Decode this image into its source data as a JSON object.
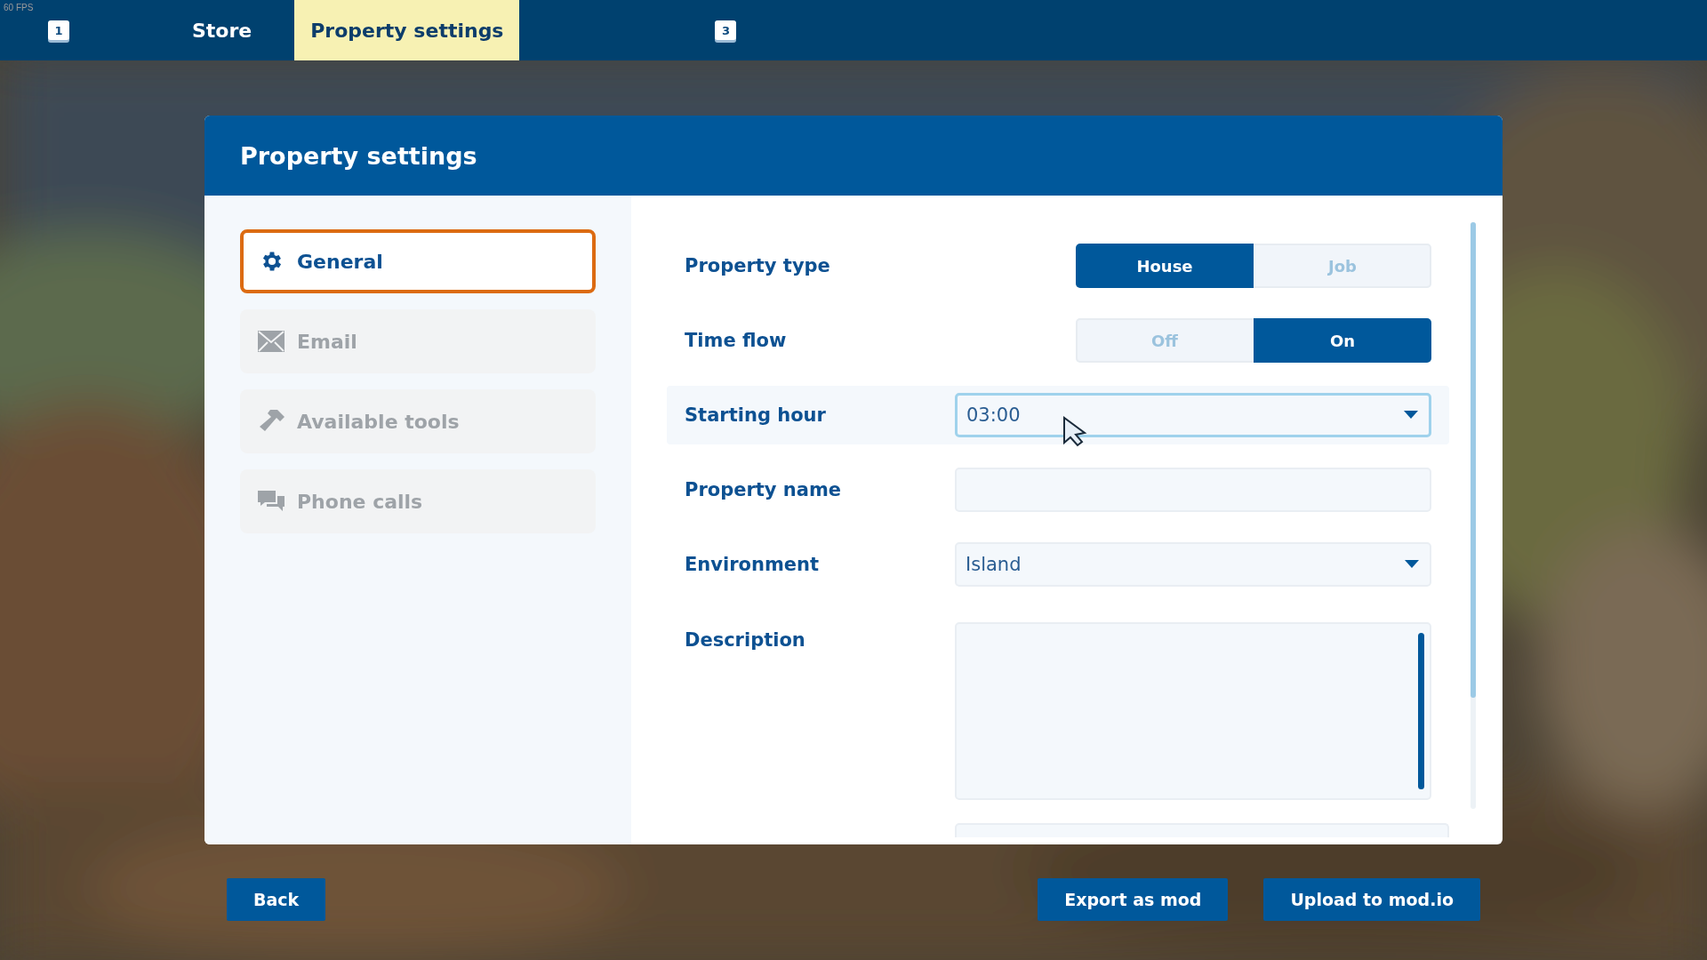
{
  "fps": "60 FPS",
  "tabs": [
    {
      "kind": "key",
      "label": "1",
      "selected": false
    },
    {
      "kind": "label",
      "label": "Store",
      "selected": false
    },
    {
      "kind": "label",
      "label": "Property settings",
      "selected": true
    },
    {
      "kind": "key",
      "label": "3",
      "selected": false
    }
  ],
  "panel": {
    "title": "Property settings"
  },
  "sidebar": {
    "items": [
      {
        "label": "General",
        "selected": true,
        "disabled": false
      },
      {
        "label": "Email",
        "selected": false,
        "disabled": true
      },
      {
        "label": "Available tools",
        "selected": false,
        "disabled": true
      },
      {
        "label": "Phone calls",
        "selected": false,
        "disabled": true
      }
    ]
  },
  "fields": [
    {
      "kind": "segmented",
      "label": "Property type",
      "focused": false,
      "options": [
        {
          "label": "House",
          "selected": true
        },
        {
          "label": "Job",
          "selected": false
        }
      ]
    },
    {
      "kind": "segmented",
      "label": "Time flow",
      "focused": false,
      "options": [
        {
          "label": "Off",
          "selected": false
        },
        {
          "label": "On",
          "selected": true
        }
      ]
    },
    {
      "kind": "select",
      "label": "Starting hour",
      "value": "03:00",
      "focused": true
    },
    {
      "kind": "text",
      "label": "Property name",
      "focused": false
    },
    {
      "kind": "select",
      "label": "Environment",
      "value": "Island",
      "focused": false
    },
    {
      "kind": "textarea",
      "label": "Description",
      "focused": false
    }
  ],
  "buttons": {
    "left": [
      "Back"
    ],
    "right": [
      "Export as mod",
      "Upload to mod.io"
    ]
  }
}
